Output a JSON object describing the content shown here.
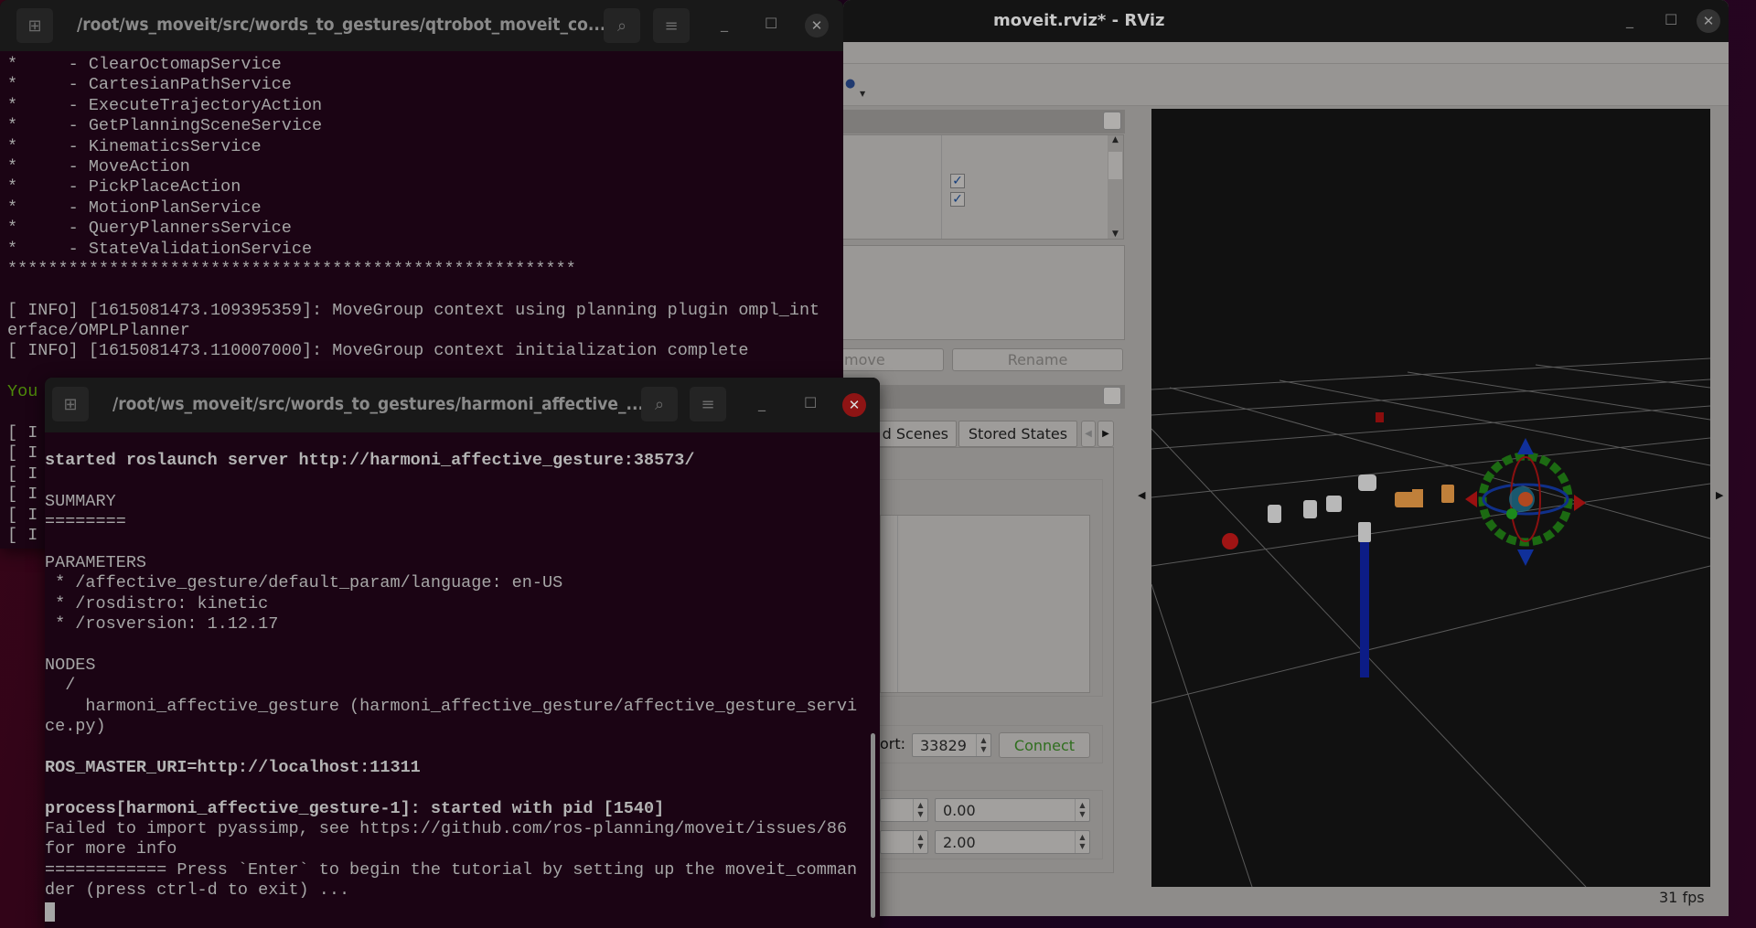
{
  "terminal_back": {
    "title": "/root/ws_moveit/src/words_to_gestures/qtrobot_moveit_co...",
    "lines": [
      "*     - ClearOctomapService",
      "*     - CartesianPathService",
      "*     - ExecuteTrajectoryAction",
      "*     - GetPlanningSceneService",
      "*     - KinematicsService",
      "*     - MoveAction",
      "*     - PickPlaceAction",
      "*     - MotionPlanService",
      "*     - QueryPlannersService",
      "*     - StateValidationService",
      "********************************************************",
      "",
      "[ INFO] [1615081473.109395359]: MoveGroup context using planning plugin ompl_int",
      "erface/OMPLPlanner",
      "[ INFO] [1615081473.110007000]: MoveGroup context initialization complete",
      "",
      "You",
      "",
      "[ I",
      "[ I",
      "[ I",
      "[ I",
      "[ I",
      "[ I"
    ]
  },
  "terminal_front": {
    "title": "/root/ws_moveit/src/words_to_gestures/harmoni_affective_...",
    "lines": [
      {
        "t": "started roslaunch server http://harmoni_affective_gesture:38573/",
        "b": true
      },
      {
        "t": ""
      },
      {
        "t": "SUMMARY"
      },
      {
        "t": "========"
      },
      {
        "t": ""
      },
      {
        "t": "PARAMETERS"
      },
      {
        "t": " * /affective_gesture/default_param/language: en-US"
      },
      {
        "t": " * /rosdistro: kinetic"
      },
      {
        "t": " * /rosversion: 1.12.17"
      },
      {
        "t": ""
      },
      {
        "t": "NODES"
      },
      {
        "t": "  /"
      },
      {
        "t": "    harmoni_affective_gesture (harmoni_affective_gesture/affective_gesture_servi"
      },
      {
        "t": "ce.py)"
      },
      {
        "t": ""
      },
      {
        "t": "ROS_MASTER_URI=http://localhost:11311",
        "b": true
      },
      {
        "t": ""
      },
      {
        "t": "process[harmoni_affective_gesture-1]: started with pid [1540]",
        "b": true
      },
      {
        "t": "Failed to import pyassimp, see https://github.com/ros-planning/moveit/issues/86"
      },
      {
        "t": "for more info"
      },
      {
        "t": "============ Press `Enter` to begin the tutorial by setting up the moveit_comman"
      },
      {
        "t": "der (press ctrl-d to exit) ..."
      }
    ]
  },
  "rviz": {
    "title": "moveit.rviz* - RViz",
    "buttons": {
      "remove": "move",
      "rename": "Rename",
      "connect": "Connect"
    },
    "tabs": [
      "d Scenes",
      "Stored States"
    ],
    "port_label": "ort:",
    "port_value": "33829",
    "spin_values": [
      "0.00",
      "2.00"
    ],
    "fps": "31 fps",
    "checkboxes": [
      true,
      true
    ],
    "colors": {
      "connect_text": "#2f6e1e",
      "viewport_bg": "#111111"
    }
  }
}
